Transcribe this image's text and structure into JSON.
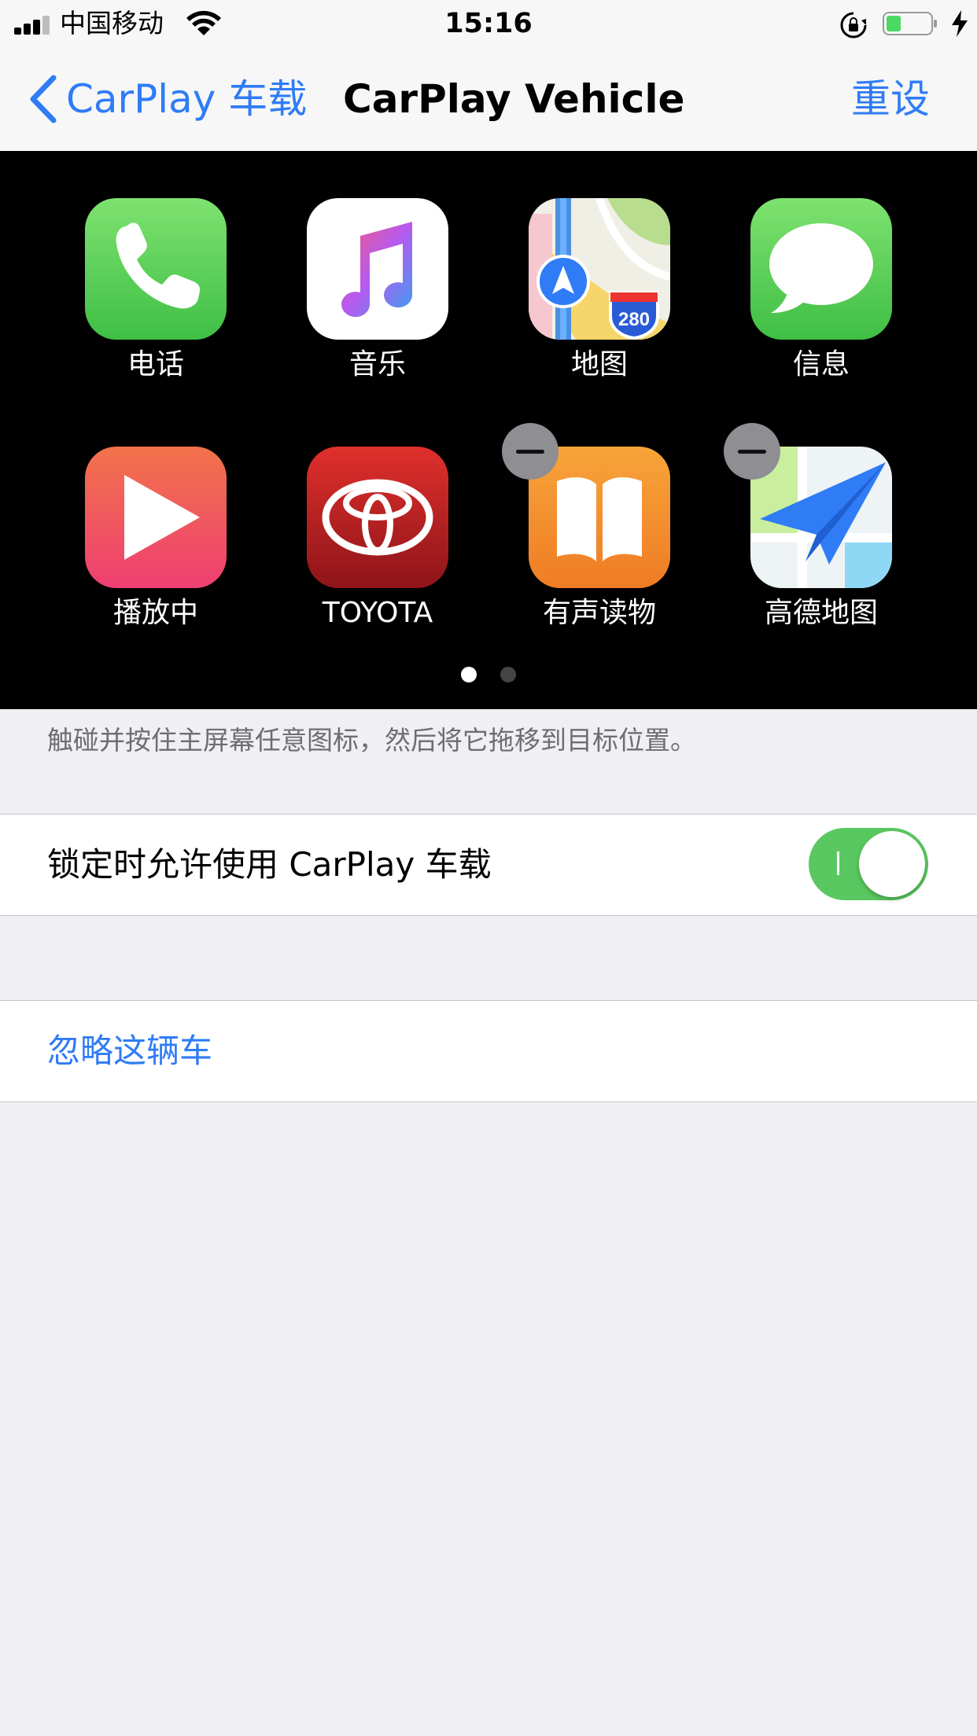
{
  "status_bar": {
    "carrier": "中国移动",
    "time": "15:16"
  },
  "nav": {
    "back_label": "CarPlay 车载",
    "title": "CarPlay Vehicle",
    "reset_label": "重设"
  },
  "carplay": {
    "apps": [
      {
        "label": "电话",
        "icon": "phone-icon",
        "removable": false
      },
      {
        "label": "音乐",
        "icon": "music-icon",
        "removable": false
      },
      {
        "label": "地图",
        "icon": "maps-icon",
        "removable": false
      },
      {
        "label": "信息",
        "icon": "messages-icon",
        "removable": false
      },
      {
        "label": "播放中",
        "icon": "now-playing-icon",
        "removable": false
      },
      {
        "label": "TOYOTA",
        "icon": "toyota-icon",
        "removable": false
      },
      {
        "label": "有声读物",
        "icon": "audiobooks-icon",
        "removable": true
      },
      {
        "label": "高德地图",
        "icon": "amap-icon",
        "removable": true
      }
    ],
    "maps_badge": "280",
    "page_count": 2,
    "current_page": 1
  },
  "hint_text": "触碰并按住主屏幕任意图标，然后将它拖移到目标位置。",
  "settings": {
    "allow_when_locked_label": "锁定时允许使用 CarPlay 车载",
    "allow_when_locked": true,
    "forget_car_label": "忽略这辆车"
  },
  "colors": {
    "accent": "#2f7cf6",
    "toggle_on": "#5ac860",
    "background": "#efeff4"
  }
}
